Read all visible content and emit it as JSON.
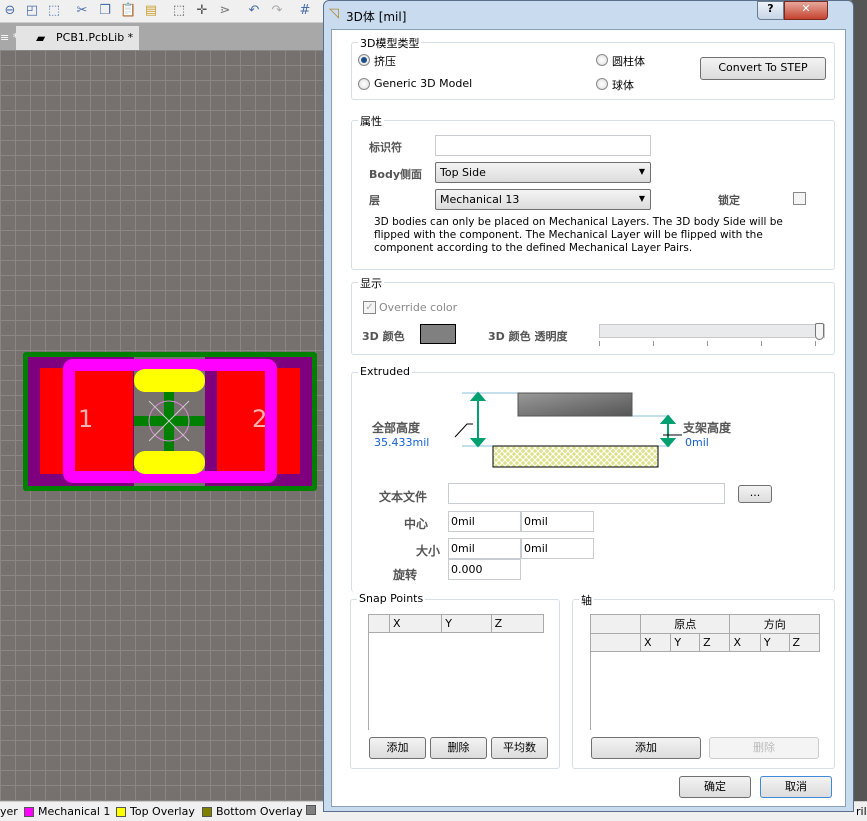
{
  "toolbar": {
    "icons": [
      "zoom-out-icon",
      "zoom-fit-icon",
      "zoom-selection-icon",
      "cut-icon",
      "copy-icon",
      "paste-icon",
      "paste-special-icon",
      "select-rect-icon",
      "move-icon",
      "select-cross-icon",
      "undo-icon",
      "redo-icon",
      "grid-icon"
    ]
  },
  "tabs": {
    "prev": "≡ *",
    "active": "PCB1.PcbLib *"
  },
  "footprint": {
    "pad1": "1",
    "pad2": "2"
  },
  "statusbar": {
    "items": [
      {
        "label": "yer",
        "color": ""
      },
      {
        "label": "Mechanical 1",
        "color": "#ff00ff"
      },
      {
        "label": "Top Overlay",
        "color": "#ffff00"
      },
      {
        "label": "Bottom Overlay",
        "color": "#808000"
      },
      {
        "label": "",
        "color": "#808080"
      }
    ],
    "right_fragment": "ril"
  },
  "dialog": {
    "title": "3D体 [mil]",
    "help": "?",
    "close": "✕",
    "model_type": {
      "legend": "3D模型类型",
      "options": [
        {
          "label": "挤压",
          "selected": true
        },
        {
          "label": "Generic 3D Model",
          "selected": false
        },
        {
          "label": "圆柱体",
          "selected": false
        },
        {
          "label": "球体",
          "selected": false
        }
      ],
      "convert": "Convert To STEP"
    },
    "properties": {
      "legend": "属性",
      "identifier_label": "标识符",
      "identifier_value": "",
      "body_side_label": "Body侧面",
      "body_side_value": "Top Side",
      "layer_label": "层",
      "layer_value": "Mechanical 13",
      "lock_label": "锁定",
      "locked": false,
      "note": "3D bodies can only be placed on Mechanical Layers. The 3D body Side will be flipped with the component. The Mechanical Layer will be flipped with the component according to the defined Mechanical Layer Pairs."
    },
    "display": {
      "legend": "显示",
      "override_label": "Override color",
      "override_checked": true,
      "color_label": "3D 颜色",
      "color": "#808080",
      "opacity_label": "3D 颜色 透明度",
      "opacity_value": 1.0
    },
    "extruded": {
      "legend": "Extruded",
      "overall_height_label": "全部高度",
      "overall_height": "35.433mil",
      "standoff_label": "支架高度",
      "standoff": "0mil",
      "text_file_label": "文本文件",
      "text_file": "",
      "browse": "...",
      "center_label": "中心",
      "center_x": "0mil",
      "center_y": "0mil",
      "size_label": "大小",
      "size_x": "0mil",
      "size_y": "0mil",
      "rotation_label": "旋转",
      "rotation": "0.000"
    },
    "snap": {
      "legend": "Snap Points",
      "cols": [
        "",
        "X",
        "Y",
        "Z"
      ],
      "add": "添加",
      "delete": "删除",
      "average": "平均数"
    },
    "axis": {
      "legend": "轴",
      "group_origin": "原点",
      "group_dir": "方向",
      "cols": [
        "X",
        "Y",
        "Z",
        "X",
        "Y",
        "Z"
      ],
      "add": "添加",
      "delete": "删除"
    },
    "ok": "确定",
    "cancel": "取消"
  }
}
